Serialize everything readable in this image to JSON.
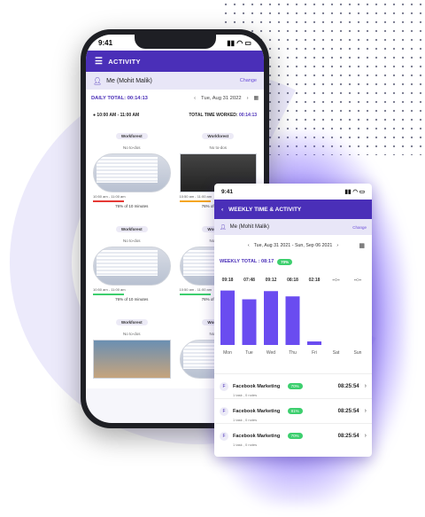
{
  "phone": {
    "time": "9:41",
    "header_title": "ACTIVITY",
    "user_name": "Me (Mohit Malik)",
    "change_label": "Change",
    "daily_total": "DAILY TOTAL: 00:14:13",
    "date": "Tue, Aug 31 2022",
    "time_slot": "10:00 AM - 11:00 AM",
    "total_worked_label": "TOTAL TIME WORKED:",
    "total_worked_value": "00:14:13",
    "cards": [
      {
        "app": "Workforest",
        "todo": "No to-dos",
        "range": "10:50 am - 11:00 am",
        "pct": "76% of 10 minutes",
        "bar_color": "#e53935",
        "shot": "screen"
      },
      {
        "app": "Workforest",
        "todo": "No to-dos",
        "range": "10:50 am - 11:00 am",
        "pct": "76% of 10 minutes",
        "bar_color": "#f5a623",
        "shot": "dark"
      },
      {
        "app": "Workforest",
        "todo": "No to-dos",
        "range": "10:50 am - 11:00 am",
        "pct": "76% of 10 minutes",
        "bar_color": "#3dcf6e",
        "shot": "screen"
      },
      {
        "app": "Workforest",
        "todo": "No to-dos",
        "range": "10:50 am - 11:00 am",
        "pct": "76% of 10 minutes",
        "bar_color": "#3dcf6e",
        "shot": "screen"
      },
      {
        "app": "Workforest",
        "todo": "No to-dos",
        "range": "",
        "pct": "",
        "bar_color": "",
        "shot": "photo"
      },
      {
        "app": "Workforest",
        "todo": "No to-dos",
        "range": "",
        "pct": "",
        "bar_color": "",
        "shot": "screen"
      }
    ]
  },
  "panel": {
    "time": "9:41",
    "header_title": "WEEKLY TIME & ACTIVITY",
    "user_name": "Me (Mohit Malik)",
    "change_label": "Change",
    "date_range": "Tue, Aug 31 2021 - Sun, Sep 06 2021",
    "weekly_total": "WEEKLY TOTAL : 08:17",
    "weekly_badge": "70%",
    "activities": [
      {
        "name": "Facebook Marketing",
        "badge": "70%",
        "sub": "1 task , 0 notes",
        "time": "08:25:54"
      },
      {
        "name": "Facebook Marketing",
        "badge": "81%",
        "sub": "1 task , 0 notes",
        "time": "08:25:54"
      },
      {
        "name": "Facebook Marketing",
        "badge": "70%",
        "sub": "1 task , 0 notes",
        "time": "08:25:54"
      }
    ]
  },
  "colors": {
    "brand": "#4a2fb8",
    "bar": "#6a4cf0",
    "success": "#3dcf6e"
  },
  "chart_data": {
    "type": "bar",
    "categories": [
      "Mon",
      "Tue",
      "Wed",
      "Thu",
      "Fri",
      "Sat",
      "Sun"
    ],
    "value_labels": [
      "09:18",
      "07:48",
      "09:12",
      "08:18",
      "02:18",
      "--:--",
      "--:--"
    ],
    "values_hours": [
      9.3,
      7.8,
      9.2,
      8.3,
      0.6,
      0,
      0
    ],
    "ylim": [
      0,
      10
    ]
  }
}
